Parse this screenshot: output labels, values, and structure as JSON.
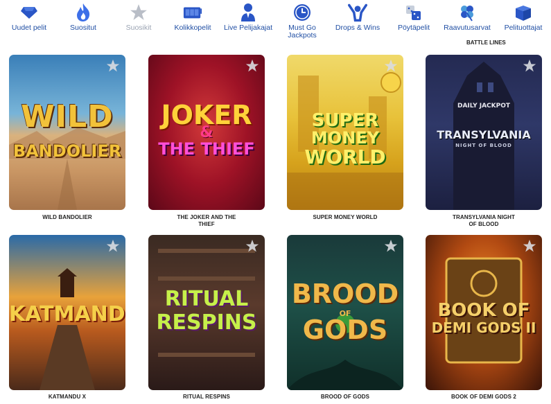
{
  "nav": {
    "items": [
      {
        "label": "Uudet pelit",
        "icon": "gem-icon"
      },
      {
        "label": "Suositut",
        "icon": "flame-icon"
      },
      {
        "label": "Suosikit",
        "icon": "star-icon"
      },
      {
        "label": "Kolikkopelit",
        "icon": "slot-machine-icon"
      },
      {
        "label": "Live Pelijakajat",
        "icon": "dealer-icon"
      },
      {
        "label": "Must Go\nJackpots",
        "icon": "clock-icon"
      },
      {
        "label": "Drops & Wins",
        "icon": "person-cheer-icon"
      },
      {
        "label": "Pöytäpelit",
        "icon": "dice-icon"
      },
      {
        "label": "Raavutusarvat",
        "icon": "clover-icon"
      },
      {
        "label": "Pelituottajat",
        "icon": "box-icon"
      }
    ],
    "sub_label": "BATTLE LINES"
  },
  "games": [
    {
      "title": "WILD BANDOLIER",
      "logo_line1": "WILD",
      "logo_line2": "BANDOLIER"
    },
    {
      "title": "THE JOKER AND THE\nTHIEF",
      "logo_line1": "JOKER",
      "logo_amp": "&",
      "logo_line2": "THE THIEF"
    },
    {
      "title": "SUPER MONEY WORLD",
      "logo_line1": "SUPER",
      "logo_line2": "MONEY",
      "logo_line3": "WORLD"
    },
    {
      "title": "TRANSYLVANIA NIGHT\nOF BLOOD",
      "logo_badge": "DAILY JACKPOT",
      "logo_line1": "TRANSYLVANIA",
      "logo_line2": "NIGHT OF BLOOD"
    },
    {
      "title": "KATMANDU X",
      "logo_line1": "KATMANDU"
    },
    {
      "title": "RITUAL RESPINS",
      "logo_line1": "RITUAL",
      "logo_line2": "RESPINS"
    },
    {
      "title": "BROOD OF GODS",
      "logo_line1": "BROOD",
      "logo_amp": "OF",
      "logo_line2": "GODS"
    },
    {
      "title": "BOOK OF DEMI GODS 2",
      "logo_line1": "BOOK OF",
      "logo_line2": "DEMI GODS II"
    }
  ],
  "colors": {
    "nav_label": "#1f4ea3",
    "nav_icon": "#2a56c6",
    "muted": "#9aa3b2",
    "card_title": "#222222"
  }
}
